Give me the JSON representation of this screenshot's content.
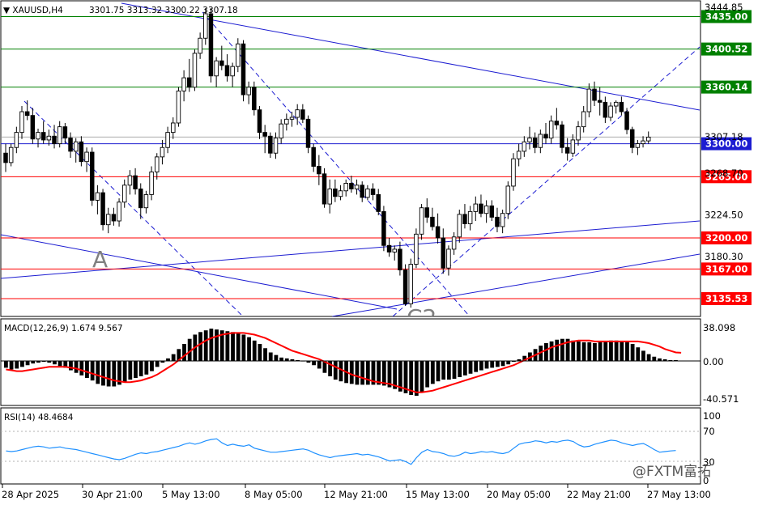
{
  "header": {
    "symbol": "XAUUSD,H4",
    "ohlc": "3301.75 3313.32 3300.22 3307.18"
  },
  "colors": {
    "bull": "#ffffff",
    "bear": "#000000",
    "green_level": "#008000",
    "red_level": "#ff0000",
    "blue_line": "#1c1cd1",
    "macd_signal": "#ff0000",
    "rsi_line": "#1e90ff"
  },
  "price_axis": {
    "labels": [
      "3444.85",
      "3307.18",
      "3268.70",
      "3224.50",
      "3180.30"
    ],
    "levels": [
      {
        "value": "3435.00",
        "color": "green"
      },
      {
        "value": "3400.52",
        "color": "green"
      },
      {
        "value": "3360.14",
        "color": "green"
      },
      {
        "value": "3300.00",
        "color": "blue"
      },
      {
        "value": "3265.00",
        "color": "red"
      },
      {
        "value": "3200.00",
        "color": "red"
      },
      {
        "value": "3167.00",
        "color": "red"
      },
      {
        "value": "3135.53",
        "color": "red"
      }
    ]
  },
  "annotations": {
    "wave_a": "A",
    "wave_c2": "C2"
  },
  "macd": {
    "label": "MACD(12,26,9) 1.674 9.567",
    "axis": [
      "38.098",
      "0.00",
      "-40.571"
    ]
  },
  "rsi": {
    "label": "RSI(14) 48.4684",
    "axis": [
      "100",
      "70",
      "30",
      "0"
    ]
  },
  "time_axis": [
    "28 Apr 2025",
    "30 Apr 21:00",
    "5 May 13:00",
    "8 May 05:00",
    "12 May 21:00",
    "15 May 13:00",
    "20 May 05:00",
    "22 May 21:00",
    "27 May 13:00"
  ],
  "watermark": "@FXTM富拓",
  "chart_data": {
    "type": "candlestick",
    "symbol": "XAUUSD",
    "timeframe": "H4",
    "ylim": [
      3120,
      3450
    ],
    "candles": [
      [
        3290,
        3300,
        3270,
        3280
      ],
      [
        3280,
        3300,
        3276,
        3296
      ],
      [
        3296,
        3318,
        3290,
        3312
      ],
      [
        3312,
        3340,
        3305,
        3334
      ],
      [
        3334,
        3346,
        3325,
        3330
      ],
      [
        3330,
        3338,
        3300,
        3305
      ],
      [
        3305,
        3316,
        3296,
        3312
      ],
      [
        3312,
        3324,
        3300,
        3304
      ],
      [
        3304,
        3315,
        3298,
        3308
      ],
      [
        3308,
        3320,
        3295,
        3300
      ],
      [
        3300,
        3324,
        3296,
        3318
      ],
      [
        3318,
        3322,
        3300,
        3306
      ],
      [
        3306,
        3312,
        3285,
        3292
      ],
      [
        3292,
        3306,
        3280,
        3302
      ],
      [
        3302,
        3308,
        3276,
        3281
      ],
      [
        3281,
        3296,
        3270,
        3291
      ],
      [
        3291,
        3296,
        3234,
        3240
      ],
      [
        3240,
        3256,
        3225,
        3248
      ],
      [
        3248,
        3252,
        3208,
        3214
      ],
      [
        3214,
        3232,
        3205,
        3225
      ],
      [
        3225,
        3232,
        3213,
        3218
      ],
      [
        3218,
        3242,
        3212,
        3238
      ],
      [
        3238,
        3262,
        3232,
        3256
      ],
      [
        3256,
        3272,
        3246,
        3266
      ],
      [
        3266,
        3274,
        3246,
        3252
      ],
      [
        3252,
        3258,
        3220,
        3232
      ],
      [
        3232,
        3250,
        3226,
        3246
      ],
      [
        3246,
        3276,
        3240,
        3270
      ],
      [
        3270,
        3290,
        3262,
        3286
      ],
      [
        3286,
        3304,
        3278,
        3296
      ],
      [
        3296,
        3318,
        3290,
        3312
      ],
      [
        3312,
        3328,
        3305,
        3322
      ],
      [
        3322,
        3360,
        3318,
        3356
      ],
      [
        3356,
        3378,
        3345,
        3370
      ],
      [
        3370,
        3390,
        3355,
        3360
      ],
      [
        3360,
        3400,
        3356,
        3396
      ],
      [
        3396,
        3418,
        3390,
        3412
      ],
      [
        3412,
        3444,
        3405,
        3438
      ],
      [
        3438,
        3444,
        3365,
        3372
      ],
      [
        3372,
        3392,
        3360,
        3388
      ],
      [
        3388,
        3404,
        3378,
        3383
      ],
      [
        3383,
        3395,
        3366,
        3372
      ],
      [
        3372,
        3386,
        3360,
        3382
      ],
      [
        3382,
        3412,
        3376,
        3406
      ],
      [
        3406,
        3410,
        3345,
        3352
      ],
      [
        3352,
        3366,
        3342,
        3360
      ],
      [
        3360,
        3366,
        3330,
        3336
      ],
      [
        3336,
        3340,
        3305,
        3312
      ],
      [
        3312,
        3320,
        3290,
        3308
      ],
      [
        3308,
        3312,
        3285,
        3290
      ],
      [
        3290,
        3312,
        3284,
        3306
      ],
      [
        3306,
        3326,
        3300,
        3321
      ],
      [
        3321,
        3332,
        3314,
        3326
      ],
      [
        3326,
        3334,
        3318,
        3328
      ],
      [
        3328,
        3342,
        3320,
        3336
      ],
      [
        3336,
        3342,
        3322,
        3326
      ],
      [
        3326,
        3330,
        3290,
        3296
      ],
      [
        3296,
        3300,
        3270,
        3276
      ],
      [
        3276,
        3288,
        3256,
        3268
      ],
      [
        3268,
        3274,
        3232,
        3236
      ],
      [
        3236,
        3262,
        3226,
        3252
      ],
      [
        3252,
        3262,
        3238,
        3244
      ],
      [
        3244,
        3256,
        3240,
        3250
      ],
      [
        3250,
        3262,
        3244,
        3258
      ],
      [
        3258,
        3266,
        3248,
        3252
      ],
      [
        3252,
        3262,
        3246,
        3256
      ],
      [
        3256,
        3260,
        3238,
        3243
      ],
      [
        3243,
        3256,
        3240,
        3252
      ],
      [
        3252,
        3258,
        3240,
        3246
      ],
      [
        3246,
        3252,
        3224,
        3228
      ],
      [
        3228,
        3234,
        3186,
        3192
      ],
      [
        3192,
        3200,
        3180,
        3185
      ],
      [
        3185,
        3192,
        3176,
        3188
      ],
      [
        3188,
        3196,
        3160,
        3166
      ],
      [
        3166,
        3172,
        3128,
        3130
      ],
      [
        3130,
        3178,
        3126,
        3172
      ],
      [
        3172,
        3210,
        3168,
        3204
      ],
      [
        3204,
        3236,
        3198,
        3232
      ],
      [
        3232,
        3242,
        3216,
        3222
      ],
      [
        3222,
        3232,
        3208,
        3212
      ],
      [
        3212,
        3226,
        3194,
        3200
      ],
      [
        3200,
        3210,
        3162,
        3168
      ],
      [
        3168,
        3192,
        3160,
        3188
      ],
      [
        3188,
        3206,
        3182,
        3201
      ],
      [
        3201,
        3230,
        3195,
        3225
      ],
      [
        3225,
        3236,
        3210,
        3215
      ],
      [
        3215,
        3234,
        3208,
        3228
      ],
      [
        3228,
        3244,
        3218,
        3236
      ],
      [
        3236,
        3246,
        3222,
        3226
      ],
      [
        3226,
        3240,
        3216,
        3234
      ],
      [
        3234,
        3240,
        3218,
        3222
      ],
      [
        3222,
        3232,
        3206,
        3212
      ],
      [
        3212,
        3230,
        3205,
        3226
      ],
      [
        3226,
        3260,
        3220,
        3255
      ],
      [
        3255,
        3290,
        3250,
        3284
      ],
      [
        3284,
        3300,
        3276,
        3292
      ],
      [
        3292,
        3308,
        3286,
        3302
      ],
      [
        3302,
        3318,
        3294,
        3306
      ],
      [
        3306,
        3312,
        3290,
        3296
      ],
      [
        3296,
        3315,
        3290,
        3310
      ],
      [
        3310,
        3322,
        3300,
        3306
      ],
      [
        3306,
        3330,
        3300,
        3324
      ],
      [
        3324,
        3338,
        3315,
        3320
      ],
      [
        3320,
        3324,
        3290,
        3296
      ],
      [
        3296,
        3306,
        3282,
        3290
      ],
      [
        3290,
        3310,
        3286,
        3304
      ],
      [
        3304,
        3324,
        3298,
        3318
      ],
      [
        3318,
        3340,
        3312,
        3334
      ],
      [
        3334,
        3364,
        3328,
        3358
      ],
      [
        3358,
        3366,
        3340,
        3346
      ],
      [
        3346,
        3360,
        3330,
        3344
      ],
      [
        3344,
        3350,
        3322,
        3328
      ],
      [
        3328,
        3344,
        3324,
        3340
      ],
      [
        3340,
        3346,
        3332,
        3344
      ],
      [
        3344,
        3350,
        3330,
        3334
      ],
      [
        3334,
        3338,
        3310,
        3315
      ],
      [
        3315,
        3318,
        3290,
        3296
      ],
      [
        3296,
        3304,
        3288,
        3300
      ],
      [
        3300,
        3308,
        3296,
        3303
      ],
      [
        3303,
        3313,
        3300,
        3307
      ]
    ],
    "horizontal_levels": [
      3435.0,
      3400.52,
      3360.14,
      3300.0,
      3265.0,
      3200.0,
      3167.0,
      3135.53
    ],
    "macd": {
      "label": "MACD(12,26,9)",
      "value": 1.674,
      "signal": 9.567,
      "ylim": [
        -40.571,
        38.098
      ],
      "histogram": [
        -8,
        -10,
        -9,
        -7,
        -5,
        -3,
        -2,
        -1,
        -2,
        -4,
        -6,
        -8,
        -11,
        -14,
        -17,
        -20,
        -23,
        -27,
        -29,
        -30,
        -30,
        -28,
        -25,
        -22,
        -20,
        -18,
        -16,
        -12,
        -7,
        -2,
        3,
        8,
        14,
        20,
        26,
        31,
        34,
        36,
        38,
        37,
        36,
        35,
        34,
        33,
        31,
        28,
        24,
        20,
        15,
        10,
        7,
        4,
        3,
        2,
        1,
        0,
        -2,
        -5,
        -9,
        -14,
        -18,
        -22,
        -24,
        -26,
        -27,
        -28,
        -28,
        -28,
        -28,
        -28,
        -29,
        -31,
        -33,
        -36,
        -38,
        -40,
        -41,
        -37,
        -31,
        -27,
        -24,
        -22,
        -22,
        -21,
        -19,
        -17,
        -15,
        -13,
        -11,
        -9,
        -8,
        -7,
        -6,
        -4,
        -1,
        2,
        6,
        10,
        14,
        18,
        21,
        23,
        25,
        26,
        26,
        24,
        23,
        22,
        22,
        21,
        22,
        23,
        24,
        24,
        23,
        22,
        20,
        16,
        12,
        8,
        5,
        3,
        2,
        1,
        1
      ],
      "signal_line": [
        -10,
        -11,
        -12,
        -12,
        -11,
        -10,
        -9,
        -8,
        -7,
        -7,
        -7,
        -7,
        -8,
        -9,
        -11,
        -13,
        -15,
        -17,
        -19,
        -21,
        -23,
        -24,
        -25,
        -25,
        -24,
        -23,
        -21,
        -19,
        -16,
        -12,
        -8,
        -4,
        1,
        6,
        11,
        16,
        20,
        24,
        27,
        29,
        31,
        32,
        33,
        33,
        33,
        32,
        31,
        29,
        27,
        24,
        21,
        18,
        15,
        12,
        10,
        8,
        6,
        4,
        2,
        -1,
        -4,
        -7,
        -10,
        -13,
        -16,
        -18,
        -20,
        -22,
        -24,
        -25,
        -26,
        -27,
        -29,
        -31,
        -33,
        -35,
        -37,
        -37,
        -36,
        -35,
        -33,
        -31,
        -29,
        -27,
        -25,
        -23,
        -21,
        -19,
        -17,
        -15,
        -13,
        -11,
        -9,
        -7,
        -5,
        -2,
        1,
        4,
        7,
        10,
        13,
        16,
        18,
        20,
        22,
        23,
        24,
        24,
        24,
        23,
        23,
        23,
        23,
        23,
        23,
        23,
        23,
        23,
        22,
        21,
        19,
        17,
        14,
        12,
        10,
        9.6
      ]
    },
    "rsi": {
      "label": "RSI(14)",
      "value": 48.4684,
      "ylim": [
        0,
        100
      ],
      "levels": [
        70,
        30
      ],
      "values": [
        48,
        47,
        48,
        50,
        52,
        54,
        55,
        54,
        52,
        53,
        54,
        52,
        51,
        50,
        48,
        46,
        44,
        42,
        40,
        38,
        36,
        35,
        37,
        40,
        43,
        45,
        44,
        46,
        47,
        49,
        51,
        53,
        55,
        58,
        60,
        58,
        60,
        63,
        65,
        66,
        60,
        56,
        58,
        56,
        55,
        57,
        52,
        50,
        48,
        46,
        46,
        47,
        48,
        49,
        50,
        51,
        49,
        45,
        42,
        40,
        38,
        40,
        41,
        42,
        43,
        44,
        42,
        43,
        41,
        39,
        36,
        33,
        34,
        35,
        32,
        28,
        38,
        46,
        50,
        47,
        46,
        44,
        41,
        40,
        42,
        46,
        44,
        45,
        47,
        46,
        47,
        45,
        44,
        46,
        52,
        58,
        60,
        61,
        63,
        62,
        60,
        62,
        61,
        63,
        64,
        62,
        57,
        54,
        55,
        58,
        60,
        62,
        64,
        63,
        60,
        58,
        56,
        58,
        59,
        55,
        50,
        46,
        47,
        48,
        48.5
      ]
    },
    "time_labels": [
      "28 Apr 2025",
      "30 Apr 21:00",
      "5 May 13:00",
      "8 May 05:00",
      "12 May 21:00",
      "15 May 13:00",
      "20 May 05:00",
      "22 May 21:00",
      "27 May 13:00"
    ]
  }
}
